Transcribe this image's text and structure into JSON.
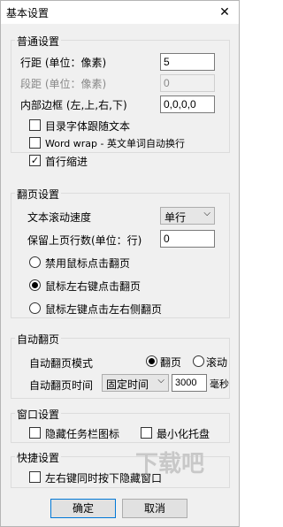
{
  "window": {
    "title": "基本设置",
    "close_glyph": "✕"
  },
  "general": {
    "title": "普通设置",
    "line_spacing_label": "行距 (单位：像素)",
    "line_spacing_value": "5",
    "para_spacing_label": "段距 (单位：像素)",
    "para_spacing_value": "0",
    "margin_label": "内部边框 (左,上,右,下)",
    "margin_value": "0,0,0,0",
    "cb_dir_font": {
      "label": "目录字体跟随文本",
      "checked": false
    },
    "cb_wordwrap": {
      "label": "Word wrap - 英文单词自动换行",
      "checked": false
    },
    "cb_indent": {
      "label": "首行缩进",
      "checked": true
    }
  },
  "page_turn": {
    "title": "翻页设置",
    "scroll_speed_label": "文本滚动速度",
    "scroll_speed_value": "单行",
    "keep_lines_label": "保留上页行数(单位：行)",
    "keep_lines_value": "0",
    "radio_disable": {
      "label": "禁用鼠标点击翻页",
      "selected": false
    },
    "radio_lr": {
      "label": "鼠标左右键点击翻页",
      "selected": true
    },
    "radio_left": {
      "label": "鼠标左键点击左右侧翻页",
      "selected": false
    }
  },
  "auto_turn": {
    "title": "自动翻页",
    "mode_label": "自动翻页模式",
    "mode_page": "翻页",
    "mode_scroll": "滚动",
    "time_label": "自动翻页时间",
    "time_select": "固定时间",
    "time_value": "3000",
    "time_unit": "毫秒"
  },
  "window_settings": {
    "title": "窗口设置",
    "cb_hide_taskbar": {
      "label": "隐藏任务栏图标",
      "checked": false
    },
    "cb_min_tray": {
      "label": "最小化托盘",
      "checked": false
    }
  },
  "shortcut": {
    "title": "快捷设置",
    "cb_hide_window": {
      "label": "左右键同时按下隐藏窗口",
      "checked": false
    }
  },
  "buttons": {
    "ok": "确定",
    "cancel": "取消"
  },
  "watermark": "下载吧"
}
